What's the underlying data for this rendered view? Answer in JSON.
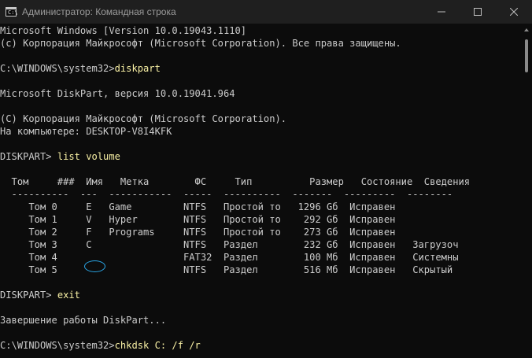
{
  "window": {
    "title": "Администратор: Командная строка",
    "icon_text": "C:\\",
    "icon": "console-icon",
    "controls": [
      "minimize-icon",
      "maximize-icon",
      "close-icon"
    ]
  },
  "console": {
    "prompt_color": "#cccccc",
    "command_color": "#f9f1a5",
    "lines": [
      {
        "text": "Microsoft Windows [Version 10.0.19043.1110]"
      },
      {
        "text": "(c) Корпорация Майкрософт (Microsoft Corporation). Все права защищены."
      },
      {
        "text": ""
      },
      {
        "prompt": "C:\\WINDOWS\\system32>",
        "cmd": "diskpart"
      },
      {
        "text": ""
      },
      {
        "text": "Microsoft DiskPart, версия 10.0.19041.964"
      },
      {
        "text": ""
      },
      {
        "text": "(C) Корпорация Майкрософт (Microsoft Corporation)."
      },
      {
        "text": "На компьютере: DESKTOP-V8I4KFK"
      },
      {
        "text": ""
      },
      {
        "prompt": "DISKPART> ",
        "cmd": "list volume"
      },
      {
        "text": ""
      },
      {
        "text": "  Том     ###  Имя   Метка        ФС     Тип          Размер   Состояние  Сведения"
      },
      {
        "text": "  ----------  ---  -----------  -----  ----------  -------  ---------  --------"
      },
      {
        "text": "     Том 0     E   Game         NTFS   Простой то   1296 Gб  Исправен"
      },
      {
        "text": "     Том 1     V   Hyper        NTFS   Простой то    292 Gб  Исправен"
      },
      {
        "text": "     Том 2     F   Programs     NTFS   Простой то    273 Gб  Исправен"
      },
      {
        "text": "     Том 3     C                NTFS   Раздел        232 Gб  Исправен   Загрузоч"
      },
      {
        "text": "     Том 4                      FAT32  Раздел        100 Мб  Исправен   Системны"
      },
      {
        "text": "     Том 5                      NTFS   Раздел        516 Мб  Исправен   Скрытый"
      },
      {
        "text": ""
      },
      {
        "prompt": "DISKPART> ",
        "cmd": "exit"
      },
      {
        "text": ""
      },
      {
        "text": "Завершение работы DiskPart..."
      },
      {
        "text": ""
      },
      {
        "prompt": "C:\\WINDOWS\\system32>",
        "cmd": "chkdsk C: /f /r"
      }
    ],
    "highlight": {
      "label": "drive-c-highlight",
      "color": "#2aa7e8"
    }
  }
}
